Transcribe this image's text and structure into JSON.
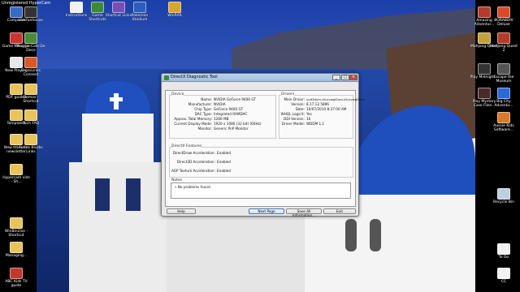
{
  "window_title": "DirectX Diagnostic Tool",
  "tabs": [
    "System",
    "Display",
    "Sound 1",
    "Sound 2",
    "Input"
  ],
  "device": {
    "title": "Device",
    "rows": [
      {
        "k": "Name:",
        "v": "NVIDIA GeForce 9400 GT"
      },
      {
        "k": "Manufacturer:",
        "v": "NVIDIA"
      },
      {
        "k": "Chip Type:",
        "v": "GeForce 9400 GT"
      },
      {
        "k": "DAC Type:",
        "v": "Integrated RAMDAC"
      },
      {
        "k": "Approx. Total Memory:",
        "v": "1266 MB"
      },
      {
        "k": "Current Display Mode:",
        "v": "1920 x 1080 (32 bit) (60Hz)"
      },
      {
        "k": "Monitor:",
        "v": "Generic PnP Monitor"
      }
    ]
  },
  "drivers": {
    "title": "Drivers",
    "rows": [
      {
        "k": "Main Driver:",
        "v": "nvd3dum.dll,nvwgf2um.dll,nvwgf2um"
      },
      {
        "k": "Version:",
        "v": "8.17.12.5896"
      },
      {
        "k": "Date:",
        "v": "10/07/2010 8:37:00 AM"
      },
      {
        "k": "WHQL Logo'd:",
        "v": "Yes"
      },
      {
        "k": "DDI Version:",
        "v": "10"
      },
      {
        "k": "Driver Model:",
        "v": "WDDM 1.1"
      }
    ]
  },
  "features": {
    "title": "DirectX Features",
    "rows": [
      {
        "k": "DirectDraw Acceleration:",
        "v": "Enabled"
      },
      {
        "k": "Direct3D Acceleration:",
        "v": "Enabled"
      },
      {
        "k": "AGP Texture Acceleration:",
        "v": "Enabled"
      }
    ]
  },
  "notes": {
    "title": "Notes",
    "items": [
      "No problems found."
    ]
  },
  "buttons": {
    "help": "Help",
    "next": "Next Page",
    "save": "Save All Information...",
    "exit": "Exit"
  },
  "desktop": {
    "top_label": "Unregistered HyperCam",
    "left_icons": [
      "Computer",
      "Game Manager",
      "Now Playing",
      "PDF guides",
      "Templates",
      "New titles for newsletter",
      "Hypercam vids - Sh...",
      "WinBin2Iso - Shortcut",
      "Managing...",
      "ABC Kids TV guide"
    ],
    "left2_icons": [
      "kidsfunhouse",
      "Play La Cale De Doce",
      "CrossLinks Connect",
      "Demos - Shortcut",
      "Tech FAQ",
      "Forms Blurbs Links"
    ],
    "top_icons": [
      "Instructions",
      "Game Shortcuts",
      "Shortcut Links",
      "Pokemon Stadium",
      "WinRAR"
    ],
    "right_icons": [
      "Amazing Adventur...",
      "Mahjong Quest",
      "Play Midnight...",
      "Play Mystery Case Files...",
      "Recycle Bin",
      "To Do",
      "CC"
    ],
    "right2_icons": [
      "BORABDIV Deluxe",
      "Mahjong Quest 2",
      "Escape the Museum",
      "Big City Adventu...",
      "Aussie Kids Software..."
    ]
  },
  "colors": {
    "sky": "#3a63c9",
    "sea": "#1d3e8f",
    "dome": "#1f4fbd",
    "dialog": "#e8e8e8"
  }
}
